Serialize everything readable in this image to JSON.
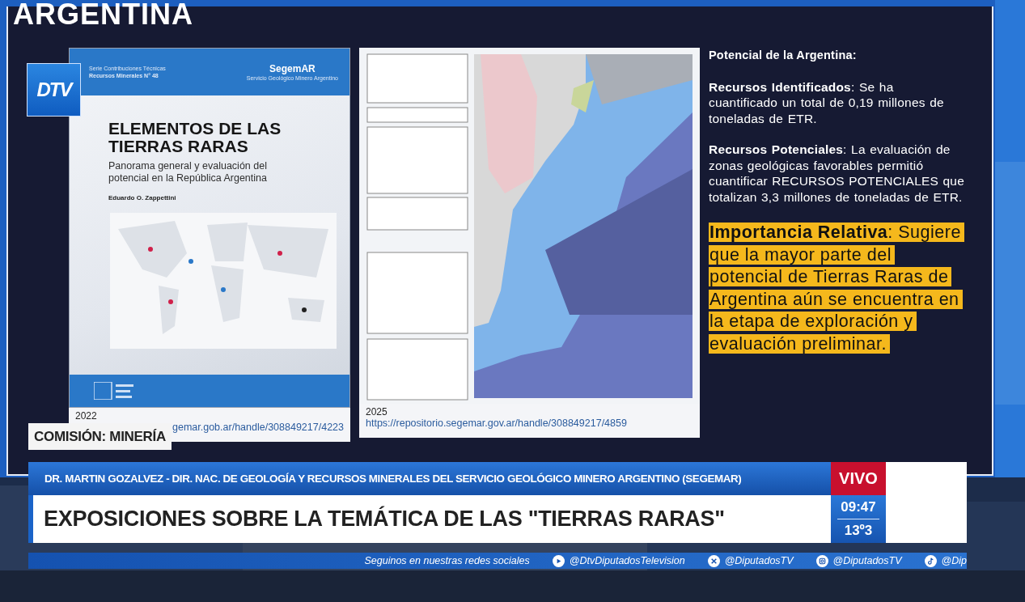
{
  "slide": {
    "title": "ARGENTINA",
    "book": {
      "series": "Serie Contribuciones Técnicas",
      "series_number": "Recursos Minerales N° 48",
      "publisher": "SegemAR",
      "publisher_subtitle": "Servicio Geológico Minero Argentino",
      "title": "ELEMENTOS DE LAS TIERRAS RARAS",
      "subtitle": "Panorama general y evaluación del potencial en la República Argentina",
      "author": "Eduardo O. Zappettini",
      "year": "2022",
      "link": "gemar.gob.ar/handle/308849217/4223"
    },
    "map": {
      "kind": "picture",
      "year": "2025",
      "link": "https://repositorio.segemar.gov.ar/handle/308849217/4859"
    },
    "heading": "Potencial de la Argentina:",
    "paragraphs": [
      "**Recursos Identificados**: Se ha cuantificado un total de 0,19 millones de toneladas de ETR.",
      "**Recursos Potenciales**: La evaluación de zonas geológicas favorables permitió cuantificar RECURSOS POTENCIALES que totalizan 3,3 millones de toneladas de ETR."
    ],
    "highlight": "**Importancia Relativa**: Sugiere que la mayor parte del potencial de Tierras Raras de Argentina aún se encuentra en la etapa de exploración y evaluación preliminar."
  },
  "channel_logo": "DTV",
  "section_tag": "COMISIÓN: MINERÍA",
  "lower_third": {
    "speaker": "DR. MARTIN GOZALVEZ - DIR. NAC. DE GEOLOGÍA Y RECURSOS MINERALES DEL SERVICIO GEOLÓGICO MINERO ARGENTINO (SEGEMAR)",
    "headline": "EXPOSICIONES SOBRE LA TEMÁTICA DE LAS \"TIERRAS RARAS\"",
    "live_label": "VIVO",
    "time": "09:47",
    "temperature": "13º3"
  },
  "ticker": [
    {
      "kind": "text",
      "text": "Seguinos en nuestras redes sociales"
    },
    {
      "kind": "play",
      "text": "@DtvDiputadosTelevision"
    },
    {
      "kind": "x",
      "text": "@DiputadosTV"
    },
    {
      "kind": "camera",
      "text": "@DiputadosTV"
    },
    {
      "kind": "note",
      "text": "@Dip"
    }
  ]
}
